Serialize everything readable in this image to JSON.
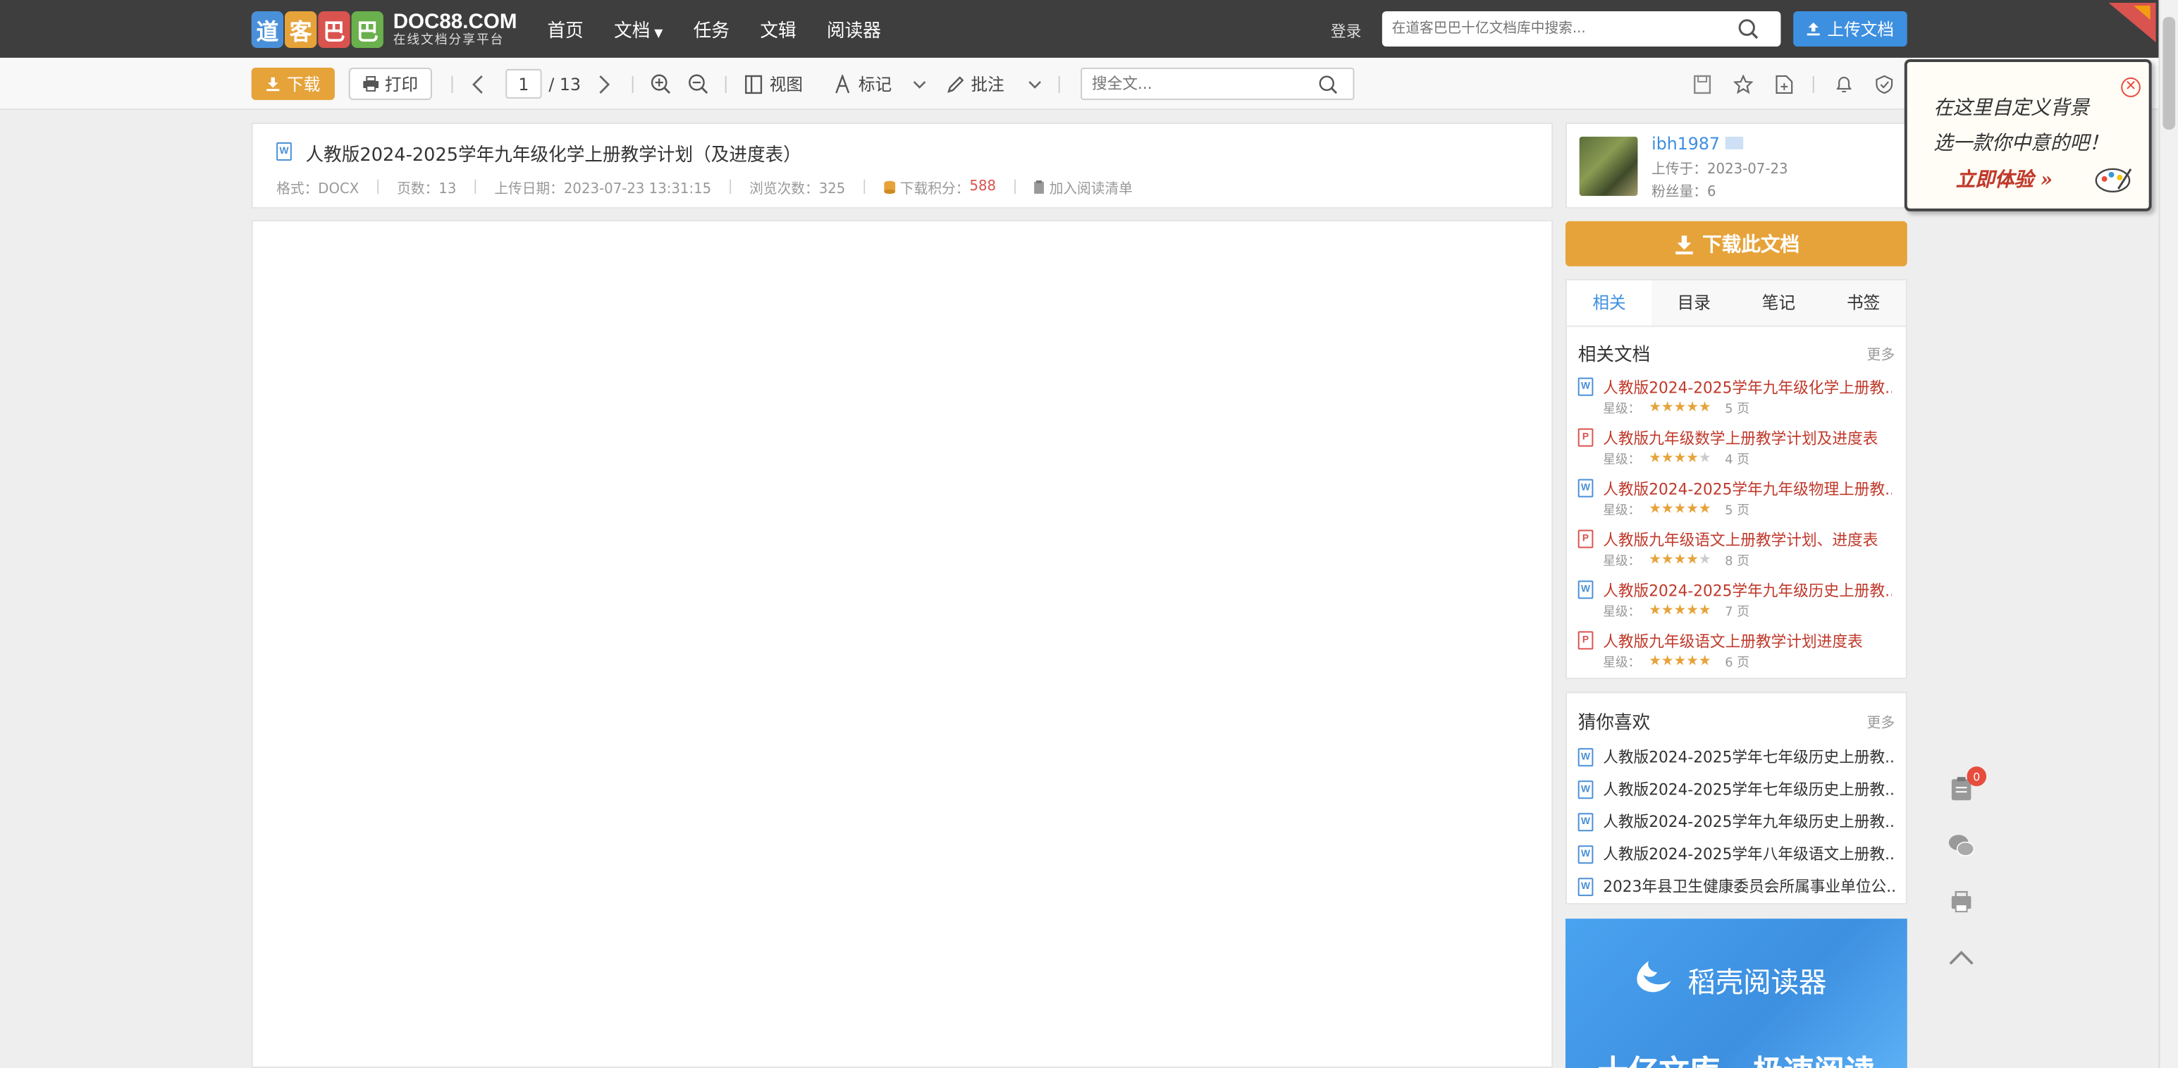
{
  "header": {
    "logo_chars": [
      "道",
      "客",
      "巴",
      "巴"
    ],
    "logo_colors": [
      "#4a90d9",
      "#e6a33a",
      "#d9534f",
      "#6ab04c"
    ],
    "logo_domain": "DOC88.COM",
    "logo_tagline": "在线文档分享平台",
    "nav": [
      "首页",
      "文档",
      "任务",
      "文辑",
      "阅读器"
    ],
    "login": "登录",
    "search_placeholder": "在道客巴巴十亿文档库中搜索...",
    "upload_label": "上传文档"
  },
  "toolbar": {
    "download_label": "下载",
    "print_label": "打印",
    "current_page": "1",
    "total_pages": "/ 13",
    "view_label": "视图",
    "mark_label": "标记",
    "annotate_label": "批注",
    "search_placeholder": "搜全文..."
  },
  "document": {
    "title": "人教版2024-2025学年九年级化学上册教学计划（及进度表）",
    "format": "格式：DOCX",
    "pages": "页数：13",
    "upload_date": "上传日期：2023-07-23 13:31:15",
    "views": "浏览次数：325",
    "points_label": "下载积分：",
    "points_value": "588",
    "add_list": "加入阅读清单"
  },
  "author": {
    "name": "ibh1987",
    "uploaded": "上传于：2023-07-23",
    "fans": "粉丝量：6"
  },
  "download_big": "下载此文档",
  "tabs": [
    "相关",
    "目录",
    "笔记",
    "书签"
  ],
  "related": {
    "title": "相关文档",
    "more": "更多",
    "star_label": "星级：",
    "items": [
      {
        "type": "W",
        "title": "人教版2024-2025学年九年级化学上册教...",
        "stars": 5,
        "pages": "5 页"
      },
      {
        "type": "P",
        "title": "人教版九年级数学上册教学计划及进度表",
        "stars": 4,
        "pages": "4 页"
      },
      {
        "type": "W",
        "title": "人教版2024-2025学年九年级物理上册教...",
        "stars": 5,
        "pages": "5 页"
      },
      {
        "type": "P",
        "title": "人教版九年级语文上册教学计划、进度表",
        "stars": 4,
        "pages": "8 页"
      },
      {
        "type": "W",
        "title": "人教版2024-2025学年九年级历史上册教...",
        "stars": 5,
        "pages": "7 页"
      },
      {
        "type": "P",
        "title": "人教版九年级语文上册教学计划进度表",
        "stars": 5,
        "pages": "6 页"
      }
    ]
  },
  "guess": {
    "title": "猜你喜欢",
    "more": "更多",
    "items": [
      "人教版2024-2025学年七年级历史上册教...",
      "人教版2024-2025学年七年级历史上册教...",
      "人教版2024-2025学年九年级历史上册教...",
      "人教版2024-2025学年八年级语文上册教...",
      "2023年县卫生健康委员会所属事业单位公..."
    ]
  },
  "ad": {
    "brand": "稻壳阅读器",
    "slogan": "十亿文库 · 极速阅读"
  },
  "float": {
    "badge": "0"
  },
  "popup": {
    "line1": "在这里自定义背景",
    "line2": "选一款你中意的吧！",
    "cta": "立即体验 »"
  }
}
